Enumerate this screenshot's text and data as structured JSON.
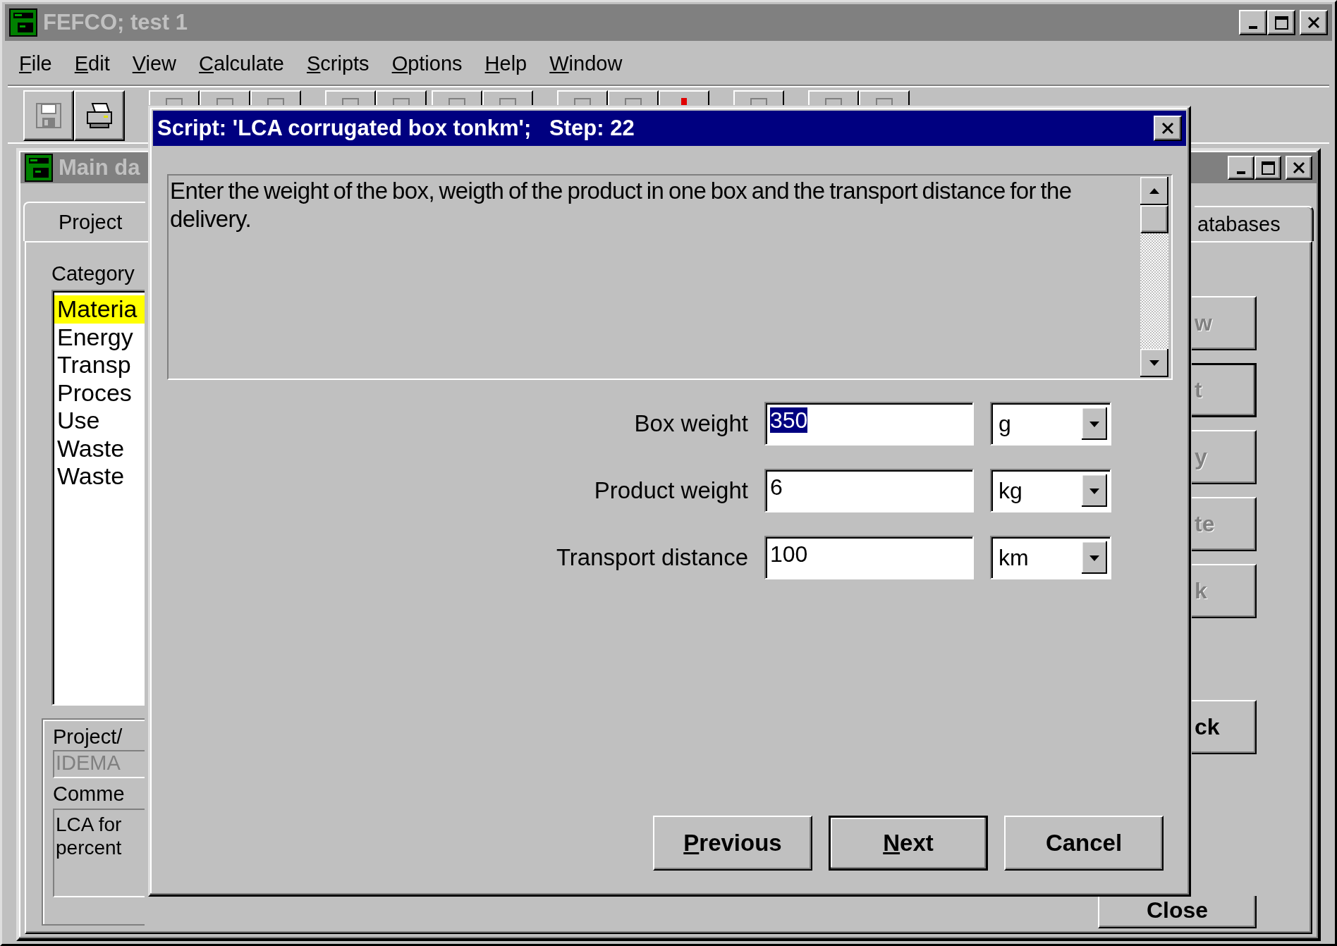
{
  "app_window": {
    "title": "FEFCO; test 1",
    "active": false
  },
  "menu": [
    "File",
    "Edit",
    "View",
    "Calculate",
    "Scripts",
    "Options",
    "Help",
    "Window"
  ],
  "toolbar": {
    "groups": [
      [
        {
          "kind": "save",
          "disabled": true
        },
        {
          "kind": "print",
          "disabled": false
        }
      ],
      [
        {
          "kind": "covered"
        },
        {
          "kind": "covered"
        },
        {
          "kind": "covered"
        }
      ],
      [
        {
          "kind": "covered"
        },
        {
          "kind": "covered"
        }
      ],
      [
        {
          "kind": "covered"
        },
        {
          "kind": "covered"
        }
      ],
      [
        {
          "kind": "covered"
        },
        {
          "kind": "covered"
        },
        {
          "kind": "covered-alert"
        }
      ],
      [
        {
          "kind": "covered"
        }
      ],
      [
        {
          "kind": "covered"
        },
        {
          "kind": "covered"
        }
      ]
    ]
  },
  "main_window": {
    "title": "Main da",
    "active": false,
    "tabs": [
      {
        "label": "Project",
        "selected": true
      },
      {
        "label": "atabases",
        "selected": false
      }
    ],
    "category_label": "Category",
    "categories": [
      {
        "label": "Materia",
        "selected": true
      },
      {
        "label": "Energy",
        "selected": false
      },
      {
        "label": "Transp",
        "selected": false
      },
      {
        "label": "Proces",
        "selected": false
      },
      {
        "label": "Use",
        "selected": false
      },
      {
        "label": "Waste",
        "selected": false
      },
      {
        "label": "Waste",
        "selected": false
      }
    ],
    "project_label": "Project/",
    "project_value": "IDEMA",
    "comment_label": "Comme",
    "comment_lines": [
      "LCA for",
      "percent"
    ],
    "buttons": [
      {
        "label": "w",
        "disabled": true,
        "default": false
      },
      {
        "label": "t",
        "disabled": true,
        "default": true
      },
      {
        "label": "y",
        "disabled": true,
        "default": false
      },
      {
        "label": "te",
        "disabled": true,
        "default": false
      },
      {
        "label": "k",
        "disabled": true,
        "default": false
      },
      {
        "label": "ck",
        "disabled": false,
        "default": false
      }
    ],
    "close_button": "Close"
  },
  "dialog": {
    "title": "Script: 'LCA corrugated box tonkm';   Step: 22",
    "message": "Enter the weight of the box, weigth of the product in one box and the transport distance for the delivery.",
    "fields": [
      {
        "label": "Box weight",
        "value": "350",
        "selected": true,
        "unit": "g"
      },
      {
        "label": "Product weight",
        "value": "6",
        "selected": false,
        "unit": "kg"
      },
      {
        "label": "Transport distance",
        "value": "100",
        "selected": false,
        "unit": "km"
      }
    ],
    "buttons": [
      {
        "label": "Previous",
        "underline_first": true,
        "default": false
      },
      {
        "label": "Next",
        "underline_first": true,
        "default": true
      },
      {
        "label": "Cancel",
        "underline_first": false,
        "default": false
      }
    ]
  }
}
